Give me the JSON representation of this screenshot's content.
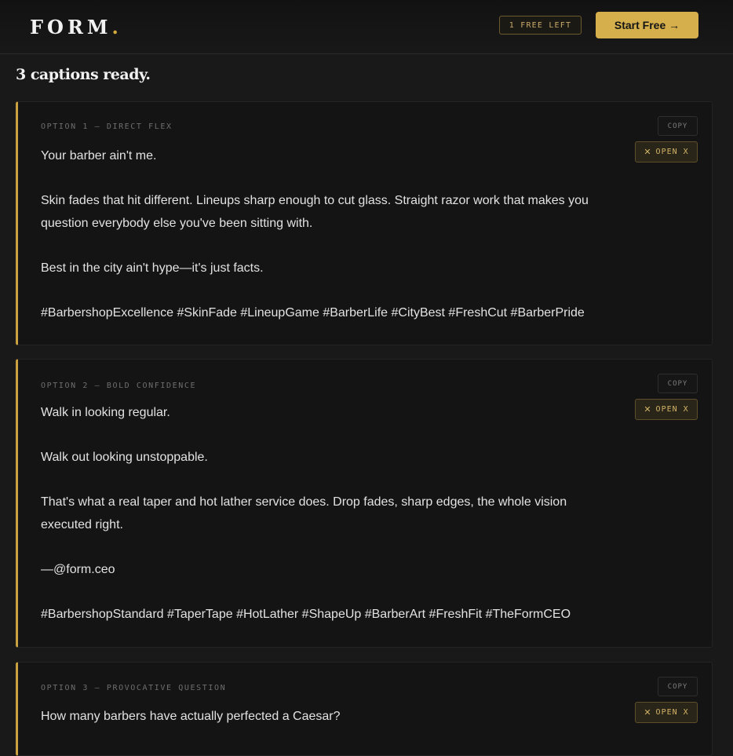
{
  "header": {
    "logo": "FORM",
    "logo_dot": ".",
    "free_badge": "1 FREE LEFT",
    "start_label": "Start Free →"
  },
  "heading": "3 captions ready.",
  "buttons": {
    "copy": "COPY",
    "open": "OPEN X",
    "open_icon": "✕"
  },
  "cards": [
    {
      "label": "OPTION 1 — DIRECT FLEX",
      "paragraphs": [
        "Your barber ain't me.",
        "Skin fades that hit different. Lineups sharp enough to cut glass. Straight razor work that makes you question everybody else you've been sitting with.",
        "Best in the city ain't hype—it's just facts."
      ],
      "hashtags": "#BarbershopExcellence #SkinFade #LineupGame #BarberLife #CityBest #FreshCut #BarberPride"
    },
    {
      "label": "OPTION 2 — BOLD CONFIDENCE",
      "paragraphs": [
        "Walk in looking regular.",
        "Walk out looking unstoppable.",
        "That's what a real taper and hot lather service does. Drop fades, sharp edges, the whole vision executed right.",
        "—@form.ceo"
      ],
      "hashtags": "#BarbershopStandard #TaperTape #HotLather #ShapeUp #BarberArt #FreshFit #TheFormCEO"
    },
    {
      "label": "OPTION 3 — PROVOCATIVE QUESTION",
      "paragraphs": [
        "How many barbers have actually perfected a Caesar?"
      ],
      "hashtags": ""
    }
  ],
  "colors": {
    "accent": "#d4af4c",
    "background": "#191919",
    "card": "#141414"
  }
}
